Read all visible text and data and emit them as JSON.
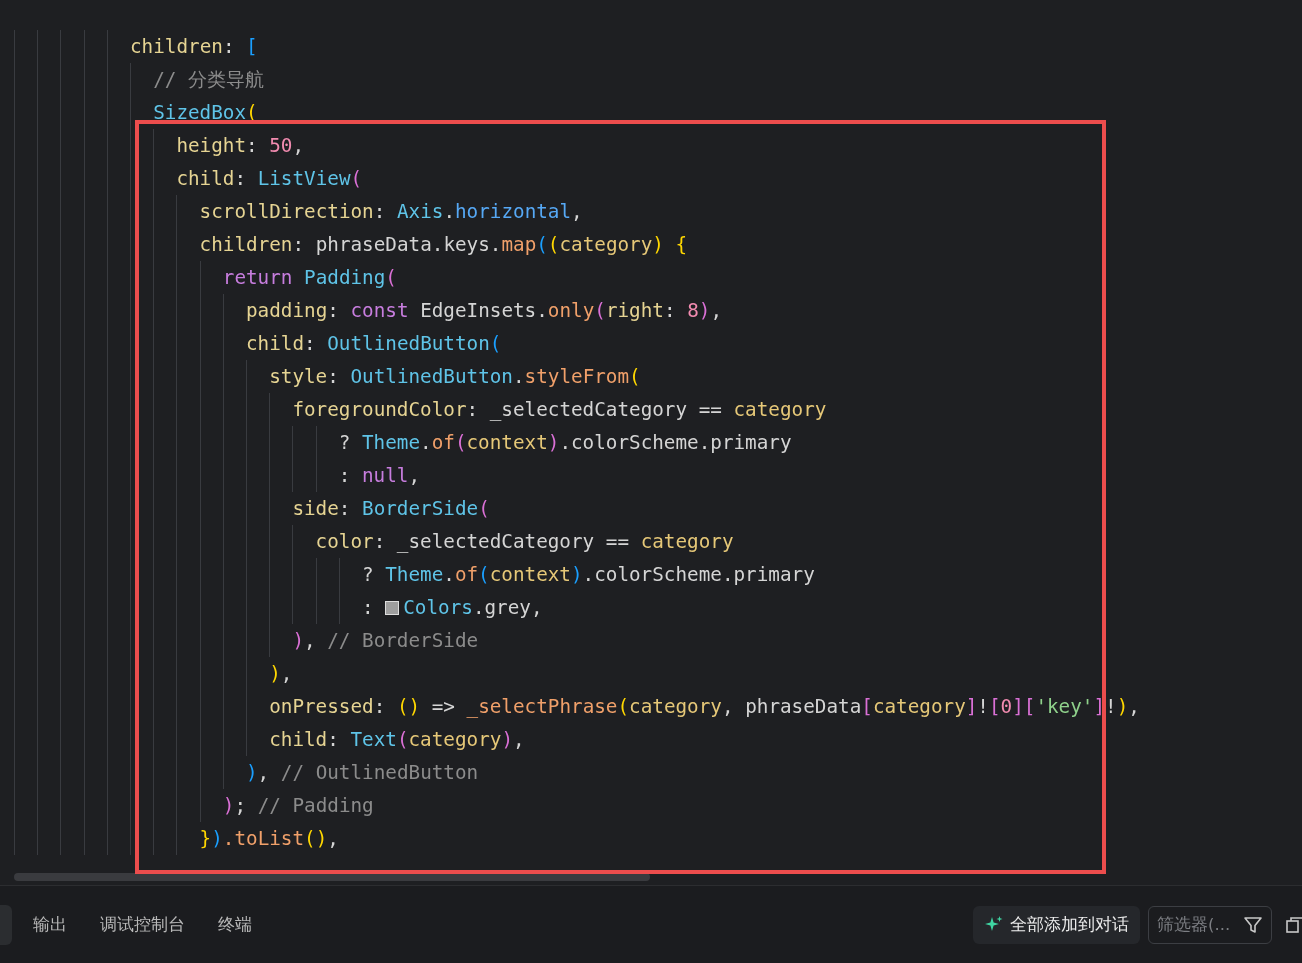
{
  "editor": {
    "lines": [
      {
        "kind": "line",
        "tokens": [
          {
            "text": "children",
            "kind": "param"
          },
          {
            "text": ": ",
            "kind": "plain"
          },
          {
            "text": "[",
            "kind": "bracket3"
          }
        ],
        "children": [
          {
            "kind": "line",
            "tokens": [
              {
                "text": "// 分类导航",
                "kind": "comment"
              }
            ]
          },
          {
            "kind": "line",
            "tokens": [
              {
                "text": "SizedBox",
                "kind": "class"
              },
              {
                "text": "(",
                "kind": "bracket1"
              }
            ],
            "children": [
              {
                "kind": "line",
                "tokens": [
                  {
                    "text": "height",
                    "kind": "param"
                  },
                  {
                    "text": ": ",
                    "kind": "plain"
                  },
                  {
                    "text": "50",
                    "kind": "number"
                  },
                  {
                    "text": ",",
                    "kind": "plain"
                  }
                ]
              },
              {
                "kind": "line",
                "tokens": [
                  {
                    "text": "child",
                    "kind": "param"
                  },
                  {
                    "text": ": ",
                    "kind": "plain"
                  },
                  {
                    "text": "ListView",
                    "kind": "class"
                  },
                  {
                    "text": "(",
                    "kind": "bracket2"
                  }
                ],
                "children": [
                  {
                    "kind": "line",
                    "tokens": [
                      {
                        "text": "scrollDirection",
                        "kind": "param"
                      },
                      {
                        "text": ": ",
                        "kind": "plain"
                      },
                      {
                        "text": "Axis",
                        "kind": "class"
                      },
                      {
                        "text": ".",
                        "kind": "plain"
                      },
                      {
                        "text": "horizontal",
                        "kind": "field"
                      },
                      {
                        "text": ",",
                        "kind": "plain"
                      }
                    ]
                  },
                  {
                    "kind": "line",
                    "tokens": [
                      {
                        "text": "children",
                        "kind": "param"
                      },
                      {
                        "text": ": phraseData.keys.",
                        "kind": "plain"
                      },
                      {
                        "text": "map",
                        "kind": "method"
                      },
                      {
                        "text": "(",
                        "kind": "bracket3"
                      },
                      {
                        "text": "(",
                        "kind": "bracket1"
                      },
                      {
                        "text": "category",
                        "kind": "variable"
                      },
                      {
                        "text": ")",
                        "kind": "bracket1"
                      },
                      {
                        "text": " {",
                        "kind": "bracket1"
                      }
                    ],
                    "children": [
                      {
                        "kind": "line",
                        "tokens": [
                          {
                            "text": "return ",
                            "kind": "keyword"
                          },
                          {
                            "text": "Padding",
                            "kind": "class"
                          },
                          {
                            "text": "(",
                            "kind": "bracket2"
                          }
                        ],
                        "children": [
                          {
                            "kind": "line",
                            "tokens": [
                              {
                                "text": "padding",
                                "kind": "param"
                              },
                              {
                                "text": ": ",
                                "kind": "plain"
                              },
                              {
                                "text": "const ",
                                "kind": "keyword"
                              },
                              {
                                "text": "EdgeInsets.",
                                "kind": "plain"
                              },
                              {
                                "text": "only",
                                "kind": "method"
                              },
                              {
                                "text": "(",
                                "kind": "bracket2"
                              },
                              {
                                "text": "right",
                                "kind": "param"
                              },
                              {
                                "text": ": ",
                                "kind": "plain"
                              },
                              {
                                "text": "8",
                                "kind": "number"
                              },
                              {
                                "text": ")",
                                "kind": "bracket2"
                              },
                              {
                                "text": ",",
                                "kind": "plain"
                              }
                            ]
                          },
                          {
                            "kind": "line",
                            "tokens": [
                              {
                                "text": "child",
                                "kind": "param"
                              },
                              {
                                "text": ": ",
                                "kind": "plain"
                              },
                              {
                                "text": "OutlinedButton",
                                "kind": "class"
                              },
                              {
                                "text": "(",
                                "kind": "bracket3"
                              }
                            ],
                            "children": [
                              {
                                "kind": "line",
                                "tokens": [
                                  {
                                    "text": "style",
                                    "kind": "param"
                                  },
                                  {
                                    "text": ": ",
                                    "kind": "plain"
                                  },
                                  {
                                    "text": "OutlinedButton",
                                    "kind": "class"
                                  },
                                  {
                                    "text": ".",
                                    "kind": "plain"
                                  },
                                  {
                                    "text": "styleFrom",
                                    "kind": "method"
                                  },
                                  {
                                    "text": "(",
                                    "kind": "bracket1"
                                  }
                                ],
                                "children": [
                                  {
                                    "kind": "line",
                                    "tokens": [
                                      {
                                        "text": "foregroundColor",
                                        "kind": "param"
                                      },
                                      {
                                        "text": ": _selectedCategory == ",
                                        "kind": "plain"
                                      },
                                      {
                                        "text": "category",
                                        "kind": "variable"
                                      }
                                    ],
                                    "children": [
                                      {
                                        "kind": "continuation",
                                        "tokens": [
                                          {
                                            "text": "? ",
                                            "kind": "plain"
                                          },
                                          {
                                            "text": "Theme",
                                            "kind": "class"
                                          },
                                          {
                                            "text": ".",
                                            "kind": "plain"
                                          },
                                          {
                                            "text": "of",
                                            "kind": "method"
                                          },
                                          {
                                            "text": "(",
                                            "kind": "bracket2"
                                          },
                                          {
                                            "text": "context",
                                            "kind": "variable"
                                          },
                                          {
                                            "text": ")",
                                            "kind": "bracket2"
                                          },
                                          {
                                            "text": ".colorScheme.primary",
                                            "kind": "plain"
                                          }
                                        ]
                                      },
                                      {
                                        "kind": "continuation",
                                        "tokens": [
                                          {
                                            "text": ": ",
                                            "kind": "plain"
                                          },
                                          {
                                            "text": "null",
                                            "kind": "keyword"
                                          },
                                          {
                                            "text": ",",
                                            "kind": "plain"
                                          }
                                        ]
                                      }
                                    ]
                                  },
                                  {
                                    "kind": "line",
                                    "tokens": [
                                      {
                                        "text": "side",
                                        "kind": "param"
                                      },
                                      {
                                        "text": ": ",
                                        "kind": "plain"
                                      },
                                      {
                                        "text": "BorderSide",
                                        "kind": "class"
                                      },
                                      {
                                        "text": "(",
                                        "kind": "bracket2"
                                      }
                                    ],
                                    "children": [
                                      {
                                        "kind": "line",
                                        "tokens": [
                                          {
                                            "text": "color",
                                            "kind": "param"
                                          },
                                          {
                                            "text": ": _selectedCategory == ",
                                            "kind": "plain"
                                          },
                                          {
                                            "text": "category",
                                            "kind": "variable"
                                          }
                                        ],
                                        "children": [
                                          {
                                            "kind": "continuation",
                                            "tokens": [
                                              {
                                                "text": "? ",
                                                "kind": "plain"
                                              },
                                              {
                                                "text": "Theme",
                                                "kind": "class"
                                              },
                                              {
                                                "text": ".",
                                                "kind": "plain"
                                              },
                                              {
                                                "text": "of",
                                                "kind": "method"
                                              },
                                              {
                                                "text": "(",
                                                "kind": "bracket3"
                                              },
                                              {
                                                "text": "context",
                                                "kind": "variable"
                                              },
                                              {
                                                "text": ")",
                                                "kind": "bracket3"
                                              },
                                              {
                                                "text": ".colorScheme.primary",
                                                "kind": "plain"
                                              }
                                            ]
                                          },
                                          {
                                            "kind": "continuation",
                                            "tokens": [
                                              {
                                                "text": ": ",
                                                "kind": "plain"
                                              },
                                              {
                                                "kind": "swatch",
                                                "color": "#9e9e9e"
                                              },
                                              {
                                                "text": "Colors",
                                                "kind": "class"
                                              },
                                              {
                                                "text": ".grey,",
                                                "kind": "plain"
                                              }
                                            ]
                                          }
                                        ]
                                      }
                                    ]
                                  },
                                  {
                                    "kind": "line",
                                    "tokens": [
                                      {
                                        "text": ")",
                                        "kind": "bracket2"
                                      },
                                      {
                                        "text": ", ",
                                        "kind": "plain"
                                      },
                                      {
                                        "text": "// BorderSide",
                                        "kind": "comment"
                                      }
                                    ]
                                  }
                                ]
                              },
                              {
                                "kind": "line",
                                "tokens": [
                                  {
                                    "text": ")",
                                    "kind": "bracket1"
                                  },
                                  {
                                    "text": ",",
                                    "kind": "plain"
                                  }
                                ]
                              },
                              {
                                "kind": "line",
                                "tokens": [
                                  {
                                    "text": "onPressed",
                                    "kind": "param"
                                  },
                                  {
                                    "text": ": ",
                                    "kind": "plain"
                                  },
                                  {
                                    "text": "()",
                                    "kind": "bracket1"
                                  },
                                  {
                                    "text": " => ",
                                    "kind": "plain"
                                  },
                                  {
                                    "text": "_selectPhrase",
                                    "kind": "method"
                                  },
                                  {
                                    "text": "(",
                                    "kind": "bracket1"
                                  },
                                  {
                                    "text": "category",
                                    "kind": "variable"
                                  },
                                  {
                                    "text": ", phraseData",
                                    "kind": "plain"
                                  },
                                  {
                                    "text": "[",
                                    "kind": "bracket2"
                                  },
                                  {
                                    "text": "category",
                                    "kind": "variable"
                                  },
                                  {
                                    "text": "]",
                                    "kind": "bracket2"
                                  },
                                  {
                                    "text": "!",
                                    "kind": "plain"
                                  },
                                  {
                                    "text": "[",
                                    "kind": "bracket2"
                                  },
                                  {
                                    "text": "0",
                                    "kind": "number"
                                  },
                                  {
                                    "text": "]",
                                    "kind": "bracket2"
                                  },
                                  {
                                    "text": "[",
                                    "kind": "bracket2"
                                  },
                                  {
                                    "text": "'key'",
                                    "kind": "string"
                                  },
                                  {
                                    "text": "]",
                                    "kind": "bracket2"
                                  },
                                  {
                                    "text": "!",
                                    "kind": "plain"
                                  },
                                  {
                                    "text": ")",
                                    "kind": "bracket1"
                                  },
                                  {
                                    "text": ",",
                                    "kind": "plain"
                                  }
                                ]
                              },
                              {
                                "kind": "line",
                                "tokens": [
                                  {
                                    "text": "child",
                                    "kind": "param"
                                  },
                                  {
                                    "text": ": ",
                                    "kind": "plain"
                                  },
                                  {
                                    "text": "Text",
                                    "kind": "class"
                                  },
                                  {
                                    "text": "(",
                                    "kind": "bracket2"
                                  },
                                  {
                                    "text": "category",
                                    "kind": "variable"
                                  },
                                  {
                                    "text": ")",
                                    "kind": "bracket2"
                                  },
                                  {
                                    "text": ",",
                                    "kind": "plain"
                                  }
                                ]
                              }
                            ]
                          },
                          {
                            "kind": "line",
                            "tokens": [
                              {
                                "text": ")",
                                "kind": "bracket3"
                              },
                              {
                                "text": ", ",
                                "kind": "plain"
                              },
                              {
                                "text": "// OutlinedButton",
                                "kind": "comment"
                              }
                            ]
                          }
                        ]
                      },
                      {
                        "kind": "line",
                        "tokens": [
                          {
                            "text": ")",
                            "kind": "bracket2"
                          },
                          {
                            "text": "; ",
                            "kind": "plain"
                          },
                          {
                            "text": "// Padding",
                            "kind": "comment"
                          }
                        ]
                      }
                    ]
                  },
                  {
                    "kind": "line",
                    "tokens": [
                      {
                        "text": "}",
                        "kind": "bracket1"
                      },
                      {
                        "text": ")",
                        "kind": "bracket3"
                      },
                      {
                        "text": ".toList",
                        "kind": "method"
                      },
                      {
                        "text": "()",
                        "kind": "bracket1"
                      },
                      {
                        "text": ",",
                        "kind": "plain"
                      }
                    ]
                  }
                ]
              }
            ]
          }
        ]
      }
    ]
  },
  "panel": {
    "tabs": [
      "输出",
      "调试控制台",
      "终端"
    ],
    "add_button": "全部添加到对话",
    "filter": {
      "placeholder": "筛选器(..."
    }
  }
}
